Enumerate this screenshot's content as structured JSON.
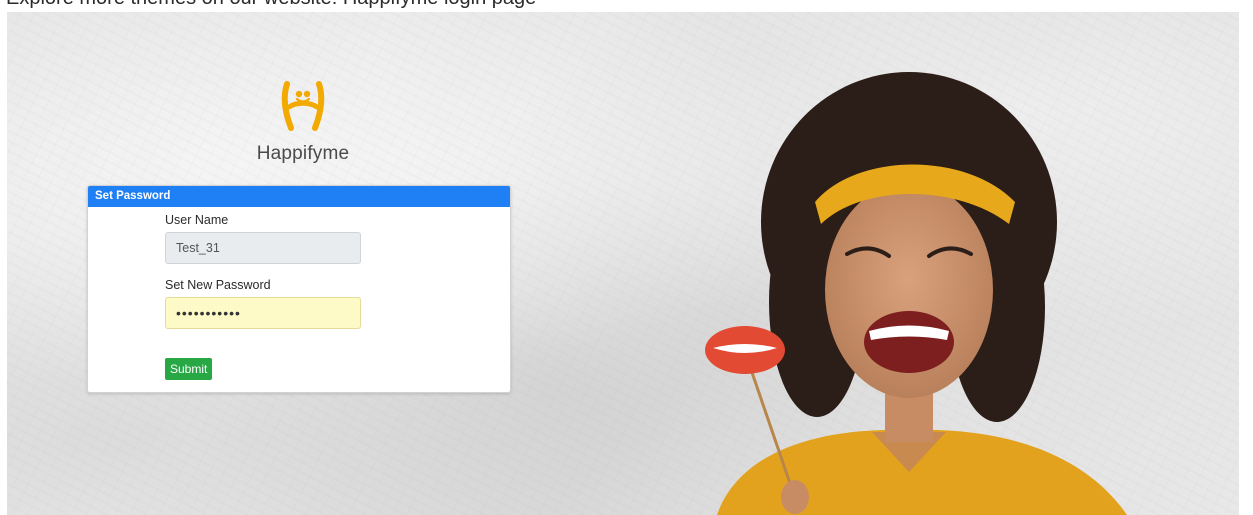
{
  "page": {
    "caption": "Explore more themes on our website: Happifyme login page"
  },
  "brand": {
    "name": "Happifyme",
    "logo_icon": "happifyme-logo-icon",
    "accent_color": "#f2a900"
  },
  "set_password": {
    "header": "Set Password",
    "header_color": "#1f7ff5",
    "username_label": "User Name",
    "username_value": "Test_31",
    "password_label": "Set New Password",
    "password_value": "•••••••••••",
    "submit_label": "Submit",
    "submit_color": "#28a745"
  },
  "hero": {
    "image": "laughing-woman-with-lips-prop-photo"
  }
}
